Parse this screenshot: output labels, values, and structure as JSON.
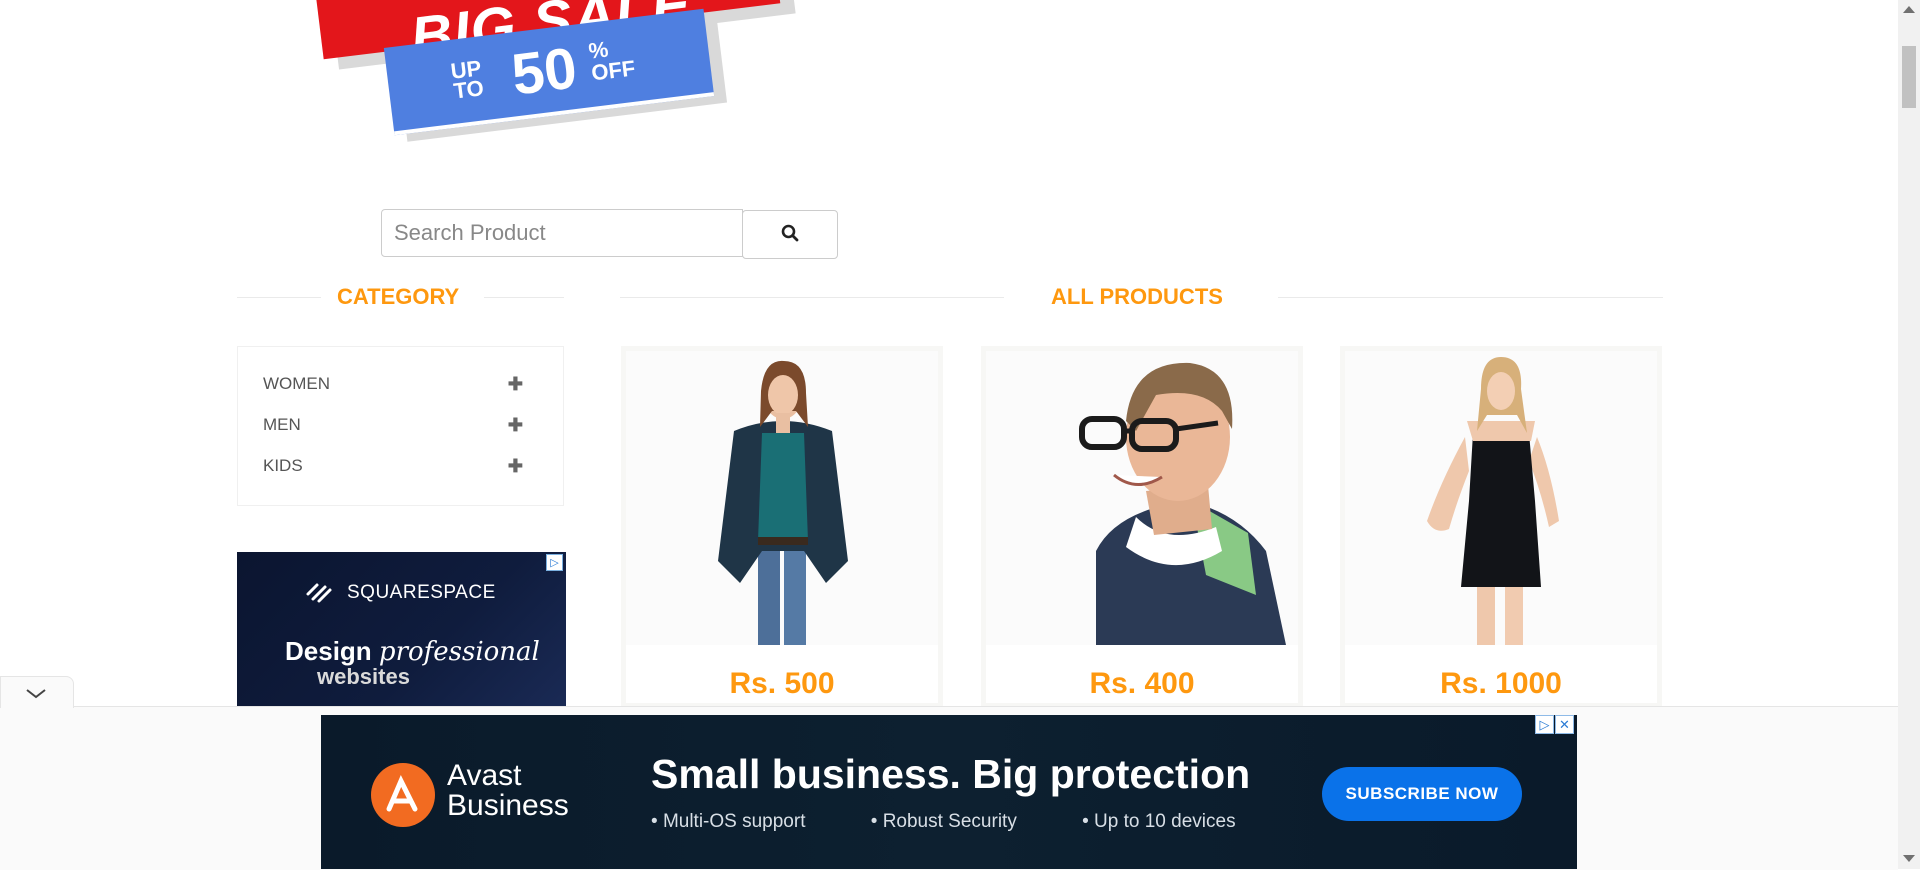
{
  "banner": {
    "big": "BIG SALE",
    "up": "UP",
    "to": "TO",
    "fifty": "50",
    "percent": "%",
    "off": "OFF"
  },
  "search": {
    "placeholder": "Search Product",
    "button_icon": "search-icon"
  },
  "category": {
    "title": "CATEGORY",
    "items": [
      {
        "label": "WOMEN",
        "icon": "plus-icon"
      },
      {
        "label": "MEN",
        "icon": "plus-icon"
      },
      {
        "label": "KIDS",
        "icon": "plus-icon"
      }
    ]
  },
  "products": {
    "title": "ALL PRODUCTS",
    "items": [
      {
        "price": "Rs. 500"
      },
      {
        "price": "Rs. 400"
      },
      {
        "price": "Rs. 1000"
      }
    ]
  },
  "side_ad": {
    "brand": "SQUARESPACE",
    "line1_a": "Design",
    "line1_b": "professional",
    "line2": "websites"
  },
  "bottom_ad": {
    "brand_line1": "Avast",
    "brand_line2": "Business",
    "headline": "Small business. Big protection",
    "bullets": [
      "Multi-OS support",
      "Robust Security",
      "Up to 10 devices"
    ],
    "cta": "SUBSCRIBE NOW"
  },
  "colors": {
    "accent": "#fe980f",
    "banner_red": "#e3161b",
    "banner_blue": "#4f7fe0",
    "cta_blue": "#0a72e9"
  }
}
